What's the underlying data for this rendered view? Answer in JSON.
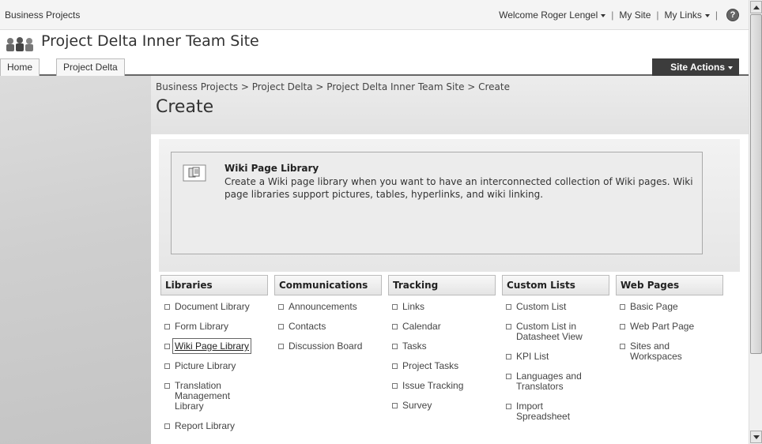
{
  "topbar": {
    "site_collection": "Business Projects",
    "welcome": "Welcome Roger Lengel",
    "my_site": "My Site",
    "my_links": "My Links",
    "sep1": "|",
    "sep2": "|",
    "sep3": "|",
    "help_icon": "help-icon"
  },
  "site": {
    "title": "Project Delta Inner Team Site",
    "logo_icon": "people-icon"
  },
  "topnav": {
    "tabs": [
      "Home",
      "Project Delta"
    ],
    "site_actions": "Site Actions"
  },
  "page": {
    "breadcrumb": "Business Projects > Project Delta > Project Delta Inner Team Site > Create",
    "title": "Create"
  },
  "preview": {
    "icon": "library-icon",
    "heading": "Wiki Page Library",
    "description": "Create a Wiki page library when you want to have an interconnected collection of Wiki pages. Wiki page libraries support pictures, tables, hyperlinks, and wiki linking."
  },
  "categories": [
    {
      "heading": "Libraries",
      "items": [
        "Document Library",
        "Form Library",
        "Wiki Page Library",
        "Picture Library",
        "Translation Management Library",
        "Report Library"
      ]
    },
    {
      "heading": "Communications",
      "items": [
        "Announcements",
        "Contacts",
        "Discussion Board"
      ]
    },
    {
      "heading": "Tracking",
      "items": [
        "Links",
        "Calendar",
        "Tasks",
        "Project Tasks",
        "Issue Tracking",
        "Survey"
      ]
    },
    {
      "heading": "Custom Lists",
      "items": [
        "Custom List",
        "Custom List in Datasheet View",
        "KPI List",
        "Languages and Translators",
        "Import Spreadsheet"
      ]
    },
    {
      "heading": "Web Pages",
      "items": [
        "Basic Page",
        "Web Part Page",
        "Sites and Workspaces"
      ]
    }
  ],
  "selected_item": "Wiki Page Library"
}
